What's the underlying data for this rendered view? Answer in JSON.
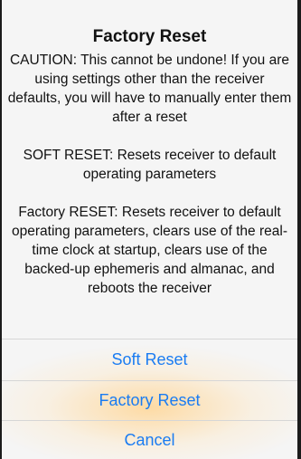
{
  "alert": {
    "title": "Factory Reset",
    "caution": "CAUTION: This cannot be undone! If you are using settings other than the receiver defaults, you will have to manually enter them after a reset",
    "soft_desc": "SOFT RESET: Resets receiver to default operating parameters",
    "factory_desc": "Factory RESET: Resets receiver to default operating parameters, clears use of the real-time clock at startup, clears use of the backed-up ephemeris and almanac, and reboots the receiver"
  },
  "buttons": {
    "soft": "Soft Reset",
    "factory": "Factory Reset",
    "cancel": "Cancel"
  },
  "colors": {
    "accent": "#1a7cf2",
    "background": "#f5f5f5",
    "highlight": "#ffd696"
  }
}
